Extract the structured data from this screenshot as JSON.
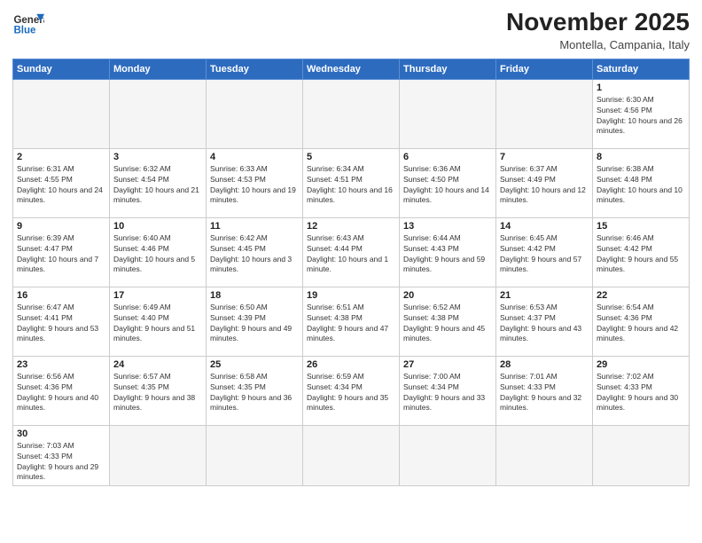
{
  "logo": {
    "general": "General",
    "blue": "Blue"
  },
  "header": {
    "month": "November 2025",
    "location": "Montella, Campania, Italy"
  },
  "weekdays": [
    "Sunday",
    "Monday",
    "Tuesday",
    "Wednesday",
    "Thursday",
    "Friday",
    "Saturday"
  ],
  "weeks": [
    [
      {
        "day": null,
        "info": ""
      },
      {
        "day": null,
        "info": ""
      },
      {
        "day": null,
        "info": ""
      },
      {
        "day": null,
        "info": ""
      },
      {
        "day": null,
        "info": ""
      },
      {
        "day": null,
        "info": ""
      },
      {
        "day": "1",
        "info": "Sunrise: 6:30 AM\nSunset: 4:56 PM\nDaylight: 10 hours and 26 minutes."
      }
    ],
    [
      {
        "day": "2",
        "info": "Sunrise: 6:31 AM\nSunset: 4:55 PM\nDaylight: 10 hours and 24 minutes."
      },
      {
        "day": "3",
        "info": "Sunrise: 6:32 AM\nSunset: 4:54 PM\nDaylight: 10 hours and 21 minutes."
      },
      {
        "day": "4",
        "info": "Sunrise: 6:33 AM\nSunset: 4:53 PM\nDaylight: 10 hours and 19 minutes."
      },
      {
        "day": "5",
        "info": "Sunrise: 6:34 AM\nSunset: 4:51 PM\nDaylight: 10 hours and 16 minutes."
      },
      {
        "day": "6",
        "info": "Sunrise: 6:36 AM\nSunset: 4:50 PM\nDaylight: 10 hours and 14 minutes."
      },
      {
        "day": "7",
        "info": "Sunrise: 6:37 AM\nSunset: 4:49 PM\nDaylight: 10 hours and 12 minutes."
      },
      {
        "day": "8",
        "info": "Sunrise: 6:38 AM\nSunset: 4:48 PM\nDaylight: 10 hours and 10 minutes."
      }
    ],
    [
      {
        "day": "9",
        "info": "Sunrise: 6:39 AM\nSunset: 4:47 PM\nDaylight: 10 hours and 7 minutes."
      },
      {
        "day": "10",
        "info": "Sunrise: 6:40 AM\nSunset: 4:46 PM\nDaylight: 10 hours and 5 minutes."
      },
      {
        "day": "11",
        "info": "Sunrise: 6:42 AM\nSunset: 4:45 PM\nDaylight: 10 hours and 3 minutes."
      },
      {
        "day": "12",
        "info": "Sunrise: 6:43 AM\nSunset: 4:44 PM\nDaylight: 10 hours and 1 minute."
      },
      {
        "day": "13",
        "info": "Sunrise: 6:44 AM\nSunset: 4:43 PM\nDaylight: 9 hours and 59 minutes."
      },
      {
        "day": "14",
        "info": "Sunrise: 6:45 AM\nSunset: 4:42 PM\nDaylight: 9 hours and 57 minutes."
      },
      {
        "day": "15",
        "info": "Sunrise: 6:46 AM\nSunset: 4:42 PM\nDaylight: 9 hours and 55 minutes."
      }
    ],
    [
      {
        "day": "16",
        "info": "Sunrise: 6:47 AM\nSunset: 4:41 PM\nDaylight: 9 hours and 53 minutes."
      },
      {
        "day": "17",
        "info": "Sunrise: 6:49 AM\nSunset: 4:40 PM\nDaylight: 9 hours and 51 minutes."
      },
      {
        "day": "18",
        "info": "Sunrise: 6:50 AM\nSunset: 4:39 PM\nDaylight: 9 hours and 49 minutes."
      },
      {
        "day": "19",
        "info": "Sunrise: 6:51 AM\nSunset: 4:38 PM\nDaylight: 9 hours and 47 minutes."
      },
      {
        "day": "20",
        "info": "Sunrise: 6:52 AM\nSunset: 4:38 PM\nDaylight: 9 hours and 45 minutes."
      },
      {
        "day": "21",
        "info": "Sunrise: 6:53 AM\nSunset: 4:37 PM\nDaylight: 9 hours and 43 minutes."
      },
      {
        "day": "22",
        "info": "Sunrise: 6:54 AM\nSunset: 4:36 PM\nDaylight: 9 hours and 42 minutes."
      }
    ],
    [
      {
        "day": "23",
        "info": "Sunrise: 6:56 AM\nSunset: 4:36 PM\nDaylight: 9 hours and 40 minutes."
      },
      {
        "day": "24",
        "info": "Sunrise: 6:57 AM\nSunset: 4:35 PM\nDaylight: 9 hours and 38 minutes."
      },
      {
        "day": "25",
        "info": "Sunrise: 6:58 AM\nSunset: 4:35 PM\nDaylight: 9 hours and 36 minutes."
      },
      {
        "day": "26",
        "info": "Sunrise: 6:59 AM\nSunset: 4:34 PM\nDaylight: 9 hours and 35 minutes."
      },
      {
        "day": "27",
        "info": "Sunrise: 7:00 AM\nSunset: 4:34 PM\nDaylight: 9 hours and 33 minutes."
      },
      {
        "day": "28",
        "info": "Sunrise: 7:01 AM\nSunset: 4:33 PM\nDaylight: 9 hours and 32 minutes."
      },
      {
        "day": "29",
        "info": "Sunrise: 7:02 AM\nSunset: 4:33 PM\nDaylight: 9 hours and 30 minutes."
      }
    ],
    [
      {
        "day": "30",
        "info": "Sunrise: 7:03 AM\nSunset: 4:33 PM\nDaylight: 9 hours and 29 minutes."
      },
      {
        "day": null,
        "info": ""
      },
      {
        "day": null,
        "info": ""
      },
      {
        "day": null,
        "info": ""
      },
      {
        "day": null,
        "info": ""
      },
      {
        "day": null,
        "info": ""
      },
      {
        "day": null,
        "info": ""
      }
    ]
  ]
}
